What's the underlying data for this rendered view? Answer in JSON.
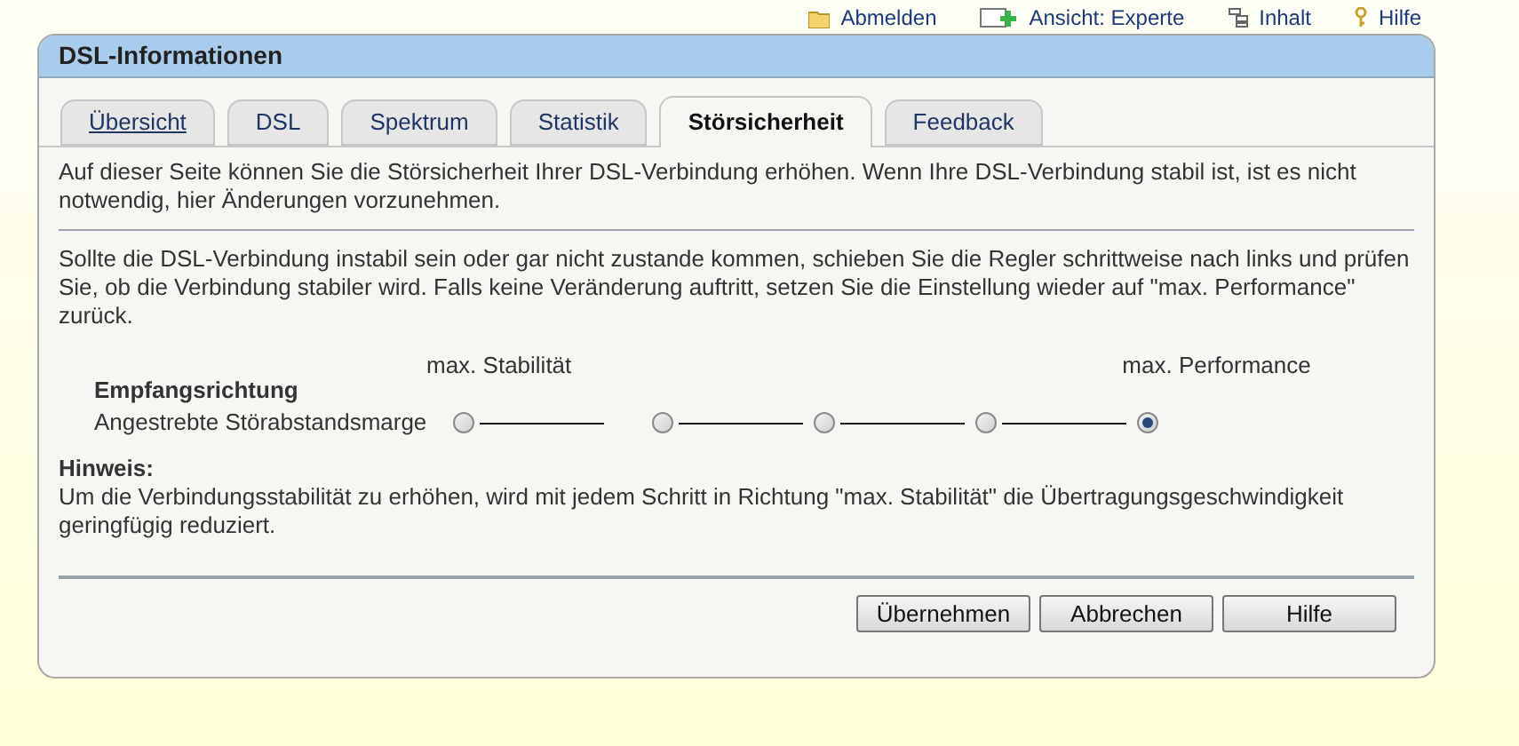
{
  "top_links": [
    {
      "label": "Abmelden"
    },
    {
      "label": "Ansicht: Experte"
    },
    {
      "label": "Inhalt"
    },
    {
      "label": "Hilfe"
    }
  ],
  "panel": {
    "title": "DSL-Informationen"
  },
  "tabs": [
    {
      "label": "Übersicht",
      "selected": false,
      "link": true
    },
    {
      "label": "DSL",
      "selected": false,
      "link": false
    },
    {
      "label": "Spektrum",
      "selected": false,
      "link": false
    },
    {
      "label": "Statistik",
      "selected": false,
      "link": false
    },
    {
      "label": "Störsicherheit",
      "selected": true,
      "link": false
    },
    {
      "label": "Feedback",
      "selected": false,
      "link": false
    }
  ],
  "intro": "Auf dieser Seite können Sie die Störsicherheit Ihrer DSL-Verbindung erhöhen. Wenn Ihre DSL-Verbindung stabil ist, ist es nicht notwendig, hier Änderungen vorzunehmen.",
  "instructions": "Sollte die DSL-Verbindung instabil sein oder gar nicht zustande kommen, schieben Sie die Regler schrittweise nach links und prüfen Sie, ob die Verbindung stabiler wird. Falls keine Veränderung auftritt, setzen Sie die Einstellung wieder auf \"max. Performance\" zurück.",
  "scale": {
    "left_label": "max. Stabilität",
    "right_label": "max. Performance"
  },
  "direction": {
    "title": "Empfangsrichtung",
    "label": "Angestrebte Störabstandsmarge",
    "steps": [
      {
        "selected": false
      },
      {
        "selected": false
      },
      {
        "selected": false
      },
      {
        "selected": false
      },
      {
        "selected": true
      }
    ]
  },
  "note": {
    "title": "Hinweis:",
    "text": "Um die Verbindungsstabilität zu erhöhen, wird mit jedem Schritt in Richtung \"max. Stabilität\" die Übertragungsgeschwindigkeit geringfügig reduziert."
  },
  "buttons": [
    "Übernehmen",
    "Abbrechen",
    "Hilfe"
  ]
}
